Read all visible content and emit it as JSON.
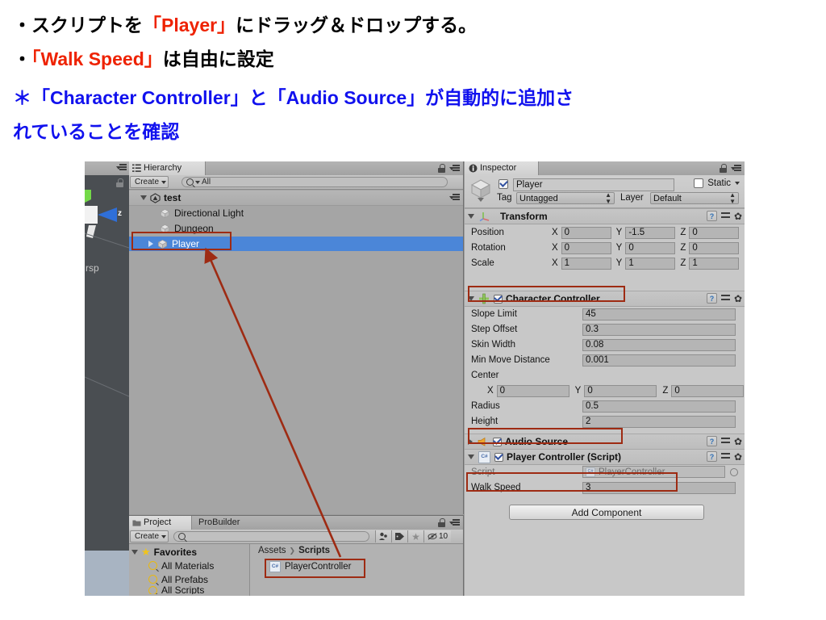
{
  "caption": {
    "line1_a": "・スクリプトを",
    "line1_b": "「Player」",
    "line1_c": "にドラッグ＆ドロップする。",
    "line2_a": "・",
    "line2_b": "「Walk Speed」",
    "line2_c": "は自由に設定",
    "line3": "＊「Character Controller」と「Audio Source」が自動的に追加さ",
    "line4": "れていることを確認",
    "red": "#ee2200",
    "blue": "#1111ee"
  },
  "annotation": {
    "box_color": "#9e2b13",
    "arrow_color": "#9e2b13"
  },
  "hierarchy": {
    "tab_label": "Hierarchy",
    "tab_icon": "hierarchy-icon",
    "create_label": "Create",
    "search_placeholder": "All",
    "search_value": "All",
    "rows": [
      {
        "label": "test",
        "icon": "unity-logo-icon",
        "indent": 14,
        "twirl": "open",
        "selected": false,
        "bold": true
      },
      {
        "label": "Directional Light",
        "icon": "gameobject-cube-icon",
        "indent": 38,
        "twirl": "none",
        "selected": false,
        "bold": false
      },
      {
        "label": "Dungeon",
        "icon": "gameobject-cube-icon",
        "indent": 38,
        "twirl": "none",
        "selected": false,
        "bold": false
      },
      {
        "label": "Player",
        "icon": "gameobject-cube-icon",
        "indent": 38,
        "twirl": "closed",
        "selected": true,
        "bold": false
      }
    ]
  },
  "project": {
    "tab_label": "Project",
    "tab2_label": "ProBuilder",
    "create_label": "Create",
    "search_value": "",
    "hidden_count": "10",
    "favorites_label": "Favorites",
    "favorites": [
      {
        "label": "All Materials"
      },
      {
        "label": "All Prefabs"
      },
      {
        "label": "All Scripts"
      }
    ],
    "breadcrumb_root": "Assets",
    "breadcrumb_sep": "❯",
    "breadcrumb_leaf": "Scripts",
    "asset_name": "PlayerController",
    "asset_icon": "csharp-script-icon"
  },
  "inspector": {
    "tab_label": "Inspector",
    "tab_icon": "info-icon",
    "object_name": "Player",
    "object_enabled": true,
    "static_label": "Static",
    "static_checked": false,
    "tag_label": "Tag",
    "tag_value": "Untagged",
    "layer_label": "Layer",
    "layer_value": "Default",
    "components": [
      {
        "name": "Transform",
        "icon": "transform-icon",
        "expanded": true,
        "has_checkbox": false,
        "vectors": [
          {
            "label": "Position",
            "x": "0",
            "y": "-1.5",
            "z": "0"
          },
          {
            "label": "Rotation",
            "x": "0",
            "y": "0",
            "z": "0"
          },
          {
            "label": "Scale",
            "x": "1",
            "y": "1",
            "z": "1"
          }
        ]
      },
      {
        "name": "Character Controller",
        "icon": "character-controller-icon",
        "expanded": true,
        "has_checkbox": true,
        "enabled": true,
        "fields": [
          {
            "label": "Slope Limit",
            "value": "45"
          },
          {
            "label": "Step Offset",
            "value": "0.3"
          },
          {
            "label": "Skin Width",
            "value": "0.08"
          },
          {
            "label": "Min Move Distance",
            "value": "0.001"
          }
        ],
        "center_label": "Center",
        "center": {
          "x": "0",
          "y": "0",
          "z": "0"
        },
        "fields2": [
          {
            "label": "Radius",
            "value": "0.5"
          },
          {
            "label": "Height",
            "value": "2"
          }
        ]
      },
      {
        "name": "Audio Source",
        "icon": "audio-source-icon",
        "expanded": false,
        "has_checkbox": true,
        "enabled": true
      },
      {
        "name": "Player Controller (Script)",
        "icon": "csharp-script-icon",
        "expanded": true,
        "has_checkbox": true,
        "enabled": true,
        "script_label": "Script",
        "script_value": "PlayerController",
        "fields": [
          {
            "label": "Walk Speed",
            "value": "3"
          }
        ]
      }
    ],
    "add_component_label": "Add Component"
  },
  "scene": {
    "axis_z_label": "z",
    "persp_label": "rsp"
  },
  "axis_labels": {
    "x": "X",
    "y": "Y",
    "z": "Z"
  }
}
